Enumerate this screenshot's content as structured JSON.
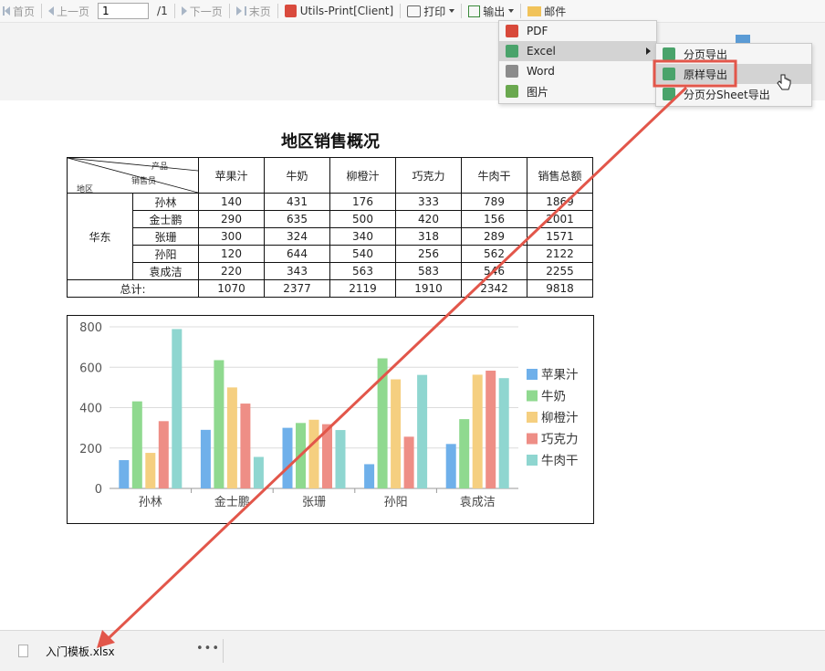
{
  "toolbar": {
    "first": "首页",
    "prev": "上一页",
    "page_current": "1",
    "page_total": "/1",
    "next": "下一页",
    "last": "末页",
    "utils_print": "Utils-Print[Client]",
    "print": "打印",
    "export": "输出",
    "mail": "邮件"
  },
  "export_menu": {
    "items": [
      "PDF",
      "Excel",
      "Word",
      "图片"
    ],
    "active": "Excel"
  },
  "excel_submenu": {
    "items": [
      "分页导出",
      "原样导出",
      "分页分Sheet导出"
    ],
    "selected": "原样导出"
  },
  "report": {
    "title": "地区销售概况",
    "diag_labels": {
      "product": "产品",
      "salesperson": "销售员",
      "region": "地区"
    },
    "columns": [
      "苹果汁",
      "牛奶",
      "柳橙汁",
      "巧克力",
      "牛肉干",
      "销售总额"
    ],
    "region": "华东",
    "rows": [
      {
        "name": "孙林",
        "values": [
          "140",
          "431",
          "176",
          "333",
          "789",
          "1869"
        ]
      },
      {
        "name": "金士鹏",
        "values": [
          "290",
          "635",
          "500",
          "420",
          "156",
          "2001"
        ]
      },
      {
        "name": "张珊",
        "values": [
          "300",
          "324",
          "340",
          "318",
          "289",
          "1571"
        ]
      },
      {
        "name": "孙阳",
        "values": [
          "120",
          "644",
          "540",
          "256",
          "562",
          "2122"
        ]
      },
      {
        "name": "袁成洁",
        "values": [
          "220",
          "343",
          "563",
          "583",
          "546",
          "2255"
        ]
      }
    ],
    "total_label": "总计:",
    "totals": [
      "1070",
      "2377",
      "2119",
      "1910",
      "2342",
      "9818"
    ]
  },
  "chart_data": {
    "type": "bar",
    "categories": [
      "孙林",
      "金士鹏",
      "张珊",
      "孙阳",
      "袁成洁"
    ],
    "series": [
      {
        "name": "苹果汁",
        "values": [
          140,
          290,
          300,
          120,
          220
        ],
        "color": "#6fb0ea"
      },
      {
        "name": "牛奶",
        "values": [
          431,
          635,
          324,
          644,
          343
        ],
        "color": "#8fd98f"
      },
      {
        "name": "柳橙汁",
        "values": [
          176,
          500,
          340,
          540,
          563
        ],
        "color": "#f5cf80"
      },
      {
        "name": "巧克力",
        "values": [
          333,
          420,
          318,
          256,
          583
        ],
        "color": "#ee8e86"
      },
      {
        "name": "牛肉干",
        "values": [
          789,
          156,
          289,
          562,
          546
        ],
        "color": "#8fd6d0"
      }
    ],
    "yticks": [
      0,
      200,
      400,
      600,
      800
    ],
    "ylim": [
      0,
      800
    ],
    "grid": true,
    "legend": "right"
  },
  "download_bar": {
    "filename": "入门模板.xlsx",
    "more": "•••"
  },
  "colors": {
    "annotation": "#e2564a",
    "menu_active": "#d3d3d3"
  }
}
